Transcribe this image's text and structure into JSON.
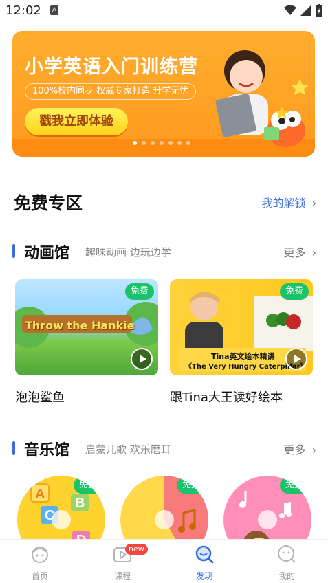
{
  "status_bar": {
    "time": "12:02",
    "notif_icon": "a-notification-icon"
  },
  "banner": {
    "title": "小学英语入门训练营",
    "subtitle": "100%校内同步  权威专家打造  升学无忧",
    "cta": "戳我立即体验",
    "dots": 7
  },
  "free_zone": {
    "title": "免费专区",
    "link": "我的解锁"
  },
  "animation": {
    "title": "动画馆",
    "subtitle": "趣味动画 边玩边学",
    "more": "更多",
    "items": [
      {
        "title": "泡泡鲨鱼",
        "badge": "免费",
        "thumb_text": "Throw the Hankie"
      },
      {
        "title": "跟Tina大王读好绘本",
        "badge": "免费",
        "thumb_text": "Tina英文绘本精讲",
        "thumb_text2": "《The Very Hungry Caterpillar》"
      }
    ]
  },
  "music": {
    "title": "音乐馆",
    "subtitle": "启蒙儿歌 欢乐磨耳",
    "more": "更多",
    "items": [
      {
        "badge": "免费"
      },
      {
        "badge": "免费"
      },
      {
        "badge": "免费"
      }
    ]
  },
  "tabs": [
    {
      "label": "首页",
      "icon": "home-icon"
    },
    {
      "label": "课程",
      "icon": "course-icon",
      "badge": "new"
    },
    {
      "label": "发现",
      "icon": "discover-icon",
      "active": true
    },
    {
      "label": "我的",
      "icon": "profile-icon"
    }
  ],
  "colors": {
    "accent": "#2f6ee0",
    "free_badge": "#19c36a",
    "banner": "#ff9a1f"
  }
}
